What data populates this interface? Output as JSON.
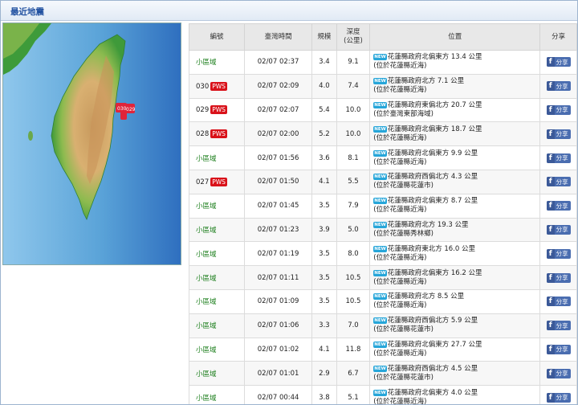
{
  "section_title": "最近地震",
  "map_markers": [
    "030",
    "029"
  ],
  "columns": {
    "id": "編號",
    "time": "臺灣時間",
    "mag": "規模",
    "depth_line1": "深度",
    "depth_line2": "(公里)",
    "loc": "位置",
    "share": "分享"
  },
  "badges": {
    "pws": "PWS",
    "new": "NEW",
    "share_label": "分享"
  },
  "quakes": [
    {
      "id": "小區域",
      "pws": false,
      "time": "02/07 02:37",
      "mag": "3.4",
      "depth": "9.1",
      "loc1": "花蓮縣政府北偏東方 13.4 公里",
      "loc2": "(位於花蓮縣近海)"
    },
    {
      "id": "030",
      "pws": true,
      "time": "02/07 02:09",
      "mag": "4.0",
      "depth": "7.4",
      "loc1": "花蓮縣政府北方 7.1 公里",
      "loc2": "(位於花蓮縣近海)"
    },
    {
      "id": "029",
      "pws": true,
      "time": "02/07 02:07",
      "mag": "5.4",
      "depth": "10.0",
      "loc1": "花蓮縣政府東偏北方 20.7 公里",
      "loc2": "(位於臺灣東部海域)"
    },
    {
      "id": "028",
      "pws": true,
      "time": "02/07 02:00",
      "mag": "5.2",
      "depth": "10.0",
      "loc1": "花蓮縣政府北偏東方 18.7 公里",
      "loc2": "(位於花蓮縣近海)"
    },
    {
      "id": "小區域",
      "pws": false,
      "time": "02/07 01:56",
      "mag": "3.6",
      "depth": "8.1",
      "loc1": "花蓮縣政府北偏東方 9.9 公里",
      "loc2": "(位於花蓮縣近海)"
    },
    {
      "id": "027",
      "pws": true,
      "time": "02/07 01:50",
      "mag": "4.1",
      "depth": "5.5",
      "loc1": "花蓮縣政府西偏北方 4.3 公里",
      "loc2": "(位於花蓮縣花蓮市)"
    },
    {
      "id": "小區域",
      "pws": false,
      "time": "02/07 01:45",
      "mag": "3.5",
      "depth": "7.9",
      "loc1": "花蓮縣政府北偏東方 8.7 公里",
      "loc2": "(位於花蓮縣近海)"
    },
    {
      "id": "小區域",
      "pws": false,
      "time": "02/07 01:23",
      "mag": "3.9",
      "depth": "5.0",
      "loc1": "花蓮縣政府北方 19.3 公里",
      "loc2": "(位於花蓮縣秀林鄉)"
    },
    {
      "id": "小區域",
      "pws": false,
      "time": "02/07 01:19",
      "mag": "3.5",
      "depth": "8.0",
      "loc1": "花蓮縣政府東北方 16.0 公里",
      "loc2": "(位於花蓮縣近海)"
    },
    {
      "id": "小區域",
      "pws": false,
      "time": "02/07 01:11",
      "mag": "3.5",
      "depth": "10.5",
      "loc1": "花蓮縣政府北偏東方 16.2 公里",
      "loc2": "(位於花蓮縣近海)"
    },
    {
      "id": "小區域",
      "pws": false,
      "time": "02/07 01:09",
      "mag": "3.5",
      "depth": "10.5",
      "loc1": "花蓮縣政府北方 8.5 公里",
      "loc2": "(位於花蓮縣近海)"
    },
    {
      "id": "小區域",
      "pws": false,
      "time": "02/07 01:06",
      "mag": "3.3",
      "depth": "7.0",
      "loc1": "花蓮縣政府西偏北方 5.9 公里",
      "loc2": "(位於花蓮縣花蓮市)"
    },
    {
      "id": "小區域",
      "pws": false,
      "time": "02/07 01:02",
      "mag": "4.1",
      "depth": "11.8",
      "loc1": "花蓮縣政府北偏東方 27.7 公里",
      "loc2": "(位於花蓮縣近海)"
    },
    {
      "id": "小區域",
      "pws": false,
      "time": "02/07 01:01",
      "mag": "2.9",
      "depth": "6.7",
      "loc1": "花蓮縣政府西偏北方 4.5 公里",
      "loc2": "(位於花蓮縣花蓮市)"
    },
    {
      "id": "小區域",
      "pws": false,
      "time": "02/07 00:44",
      "mag": "3.8",
      "depth": "5.1",
      "loc1": "花蓮縣政府北偏東方 4.0 公里",
      "loc2": "(位於花蓮縣近海)"
    }
  ]
}
